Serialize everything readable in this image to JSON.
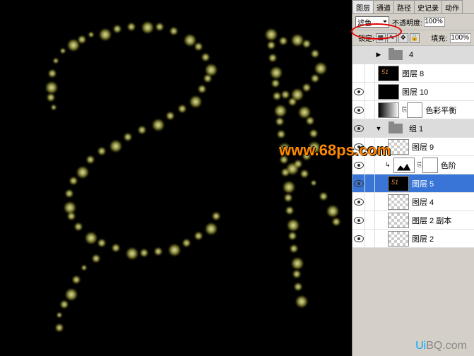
{
  "tabs": {
    "layers": "图层",
    "channels": "通道",
    "paths": "路径",
    "history": "史记录",
    "actions": "动作"
  },
  "blend_mode": "滤色",
  "opacity_label": "不透明度:",
  "opacity_value": "100%",
  "lock_label": "锁定:",
  "fill_label": "填充:",
  "fill_value": "100%",
  "layers": {
    "l1": "4",
    "l2": "图层 8",
    "l3": "图层 10",
    "l4": "色彩平衡",
    "l5": "组 1",
    "l6": "图层 9",
    "l7": "色阶",
    "l8": "图层 5",
    "l9": "图层 4",
    "l10": "图层 2 副本",
    "l11": "图层 2"
  },
  "watermark": "www.68ps.com",
  "bottom_wm_ui": "Ui",
  "bottom_wm_rest": "BQ.com"
}
